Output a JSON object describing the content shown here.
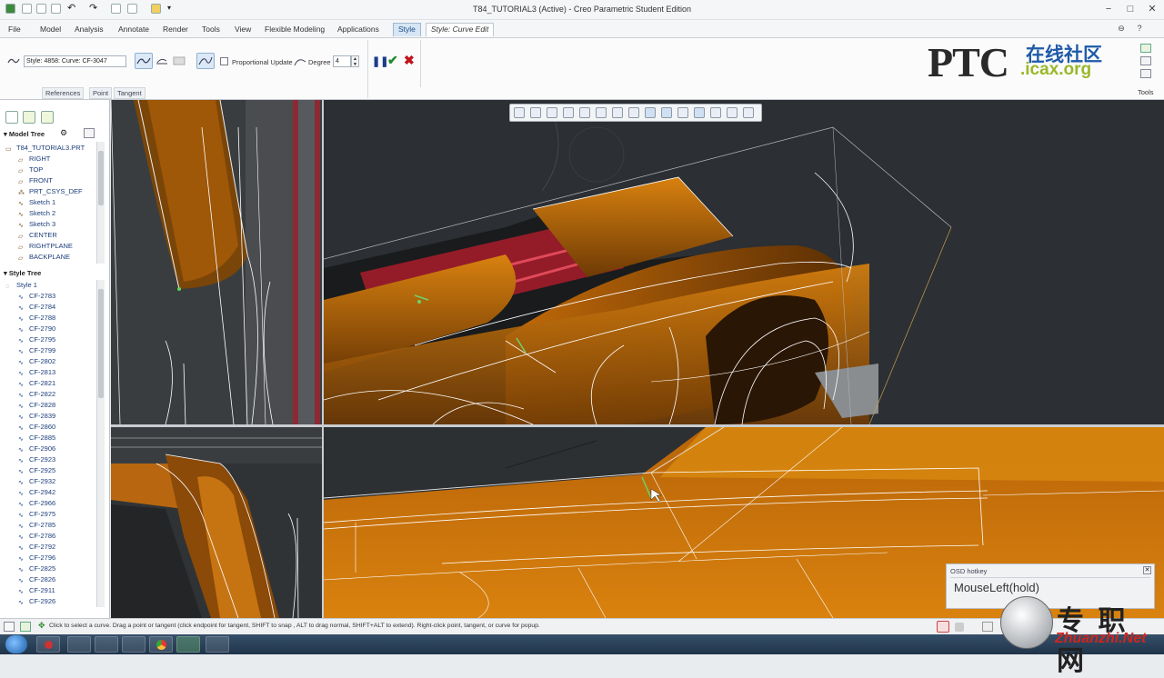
{
  "window": {
    "title": "T84_TUTORIAL3 (Active) - Creo Parametric Student Edition",
    "minimize": "−",
    "maximize": "□",
    "close": "✕"
  },
  "menu": {
    "tabs": [
      "File",
      "Model",
      "Analysis",
      "Annotate",
      "Render",
      "Tools",
      "View",
      "Flexible Modeling",
      "Applications",
      "Style",
      "Style: Curve Edit"
    ],
    "active": "Style"
  },
  "ribbon": {
    "curve_field": "Style: 4858: Curve:  CF-3047",
    "proportional_update": "Proportional Update",
    "degree_label": "Degree",
    "degree_value": "4",
    "subtabs": [
      "References",
      "Point",
      "Tangent"
    ],
    "tools_label": "Tools"
  },
  "logo": {
    "ptc": "PTC",
    "chinese": "在线社区",
    "site": ".icax.org"
  },
  "model_tree": {
    "header": "Model Tree",
    "items": [
      {
        "label": "T84_TUTORIAL3.PRT",
        "icon": "part-icon"
      },
      {
        "label": "RIGHT",
        "icon": "datum-plane-icon"
      },
      {
        "label": "TOP",
        "icon": "datum-plane-icon"
      },
      {
        "label": "FRONT",
        "icon": "datum-plane-icon"
      },
      {
        "label": "PRT_CSYS_DEF",
        "icon": "csys-icon"
      },
      {
        "label": "Sketch 1",
        "icon": "sketch-icon"
      },
      {
        "label": "Sketch 2",
        "icon": "sketch-icon"
      },
      {
        "label": "Sketch 3",
        "icon": "sketch-icon"
      },
      {
        "label": "CENTER",
        "icon": "datum-plane-icon"
      },
      {
        "label": "RIGHTPLANE",
        "icon": "datum-plane-icon"
      },
      {
        "label": "BACKPLANE",
        "icon": "datum-plane-icon"
      }
    ]
  },
  "style_tree": {
    "header": "Style Tree",
    "root": "Style 1",
    "items": [
      "CF-2783",
      "CF-2784",
      "CF-2788",
      "CF-2790",
      "CF-2795",
      "CF-2799",
      "CF-2802",
      "CF-2813",
      "CF-2821",
      "CF-2822",
      "CF-2828",
      "CF-2839",
      "CF-2860",
      "CF-2885",
      "CF-2906",
      "CF-2923",
      "CF-2925",
      "CF-2932",
      "CF-2942",
      "CF-2966",
      "CF-2975",
      "CF-2785",
      "CF-2786",
      "CF-2792",
      "CF-2796",
      "CF-2825",
      "CF-2826",
      "CF-2911",
      "CF-2926"
    ]
  },
  "osd": {
    "title": "OSD hotkey",
    "text": "MouseLeft(hold)"
  },
  "status": {
    "message": "Click to select a curve. Drag a point or tangent (click endpoint for tangent, SHIFT to snap , ALT to drag normal, SHIFT+ALT to extend). Right-click point, tangent, or curve for popup."
  },
  "watermark": {
    "chinese": "专 职 网",
    "site": "Zhuanzhi.Net"
  },
  "colors": {
    "accent": "#1a4e8a",
    "surface_orange": "#c9700f",
    "viewport_bg": "#2f3236"
  }
}
